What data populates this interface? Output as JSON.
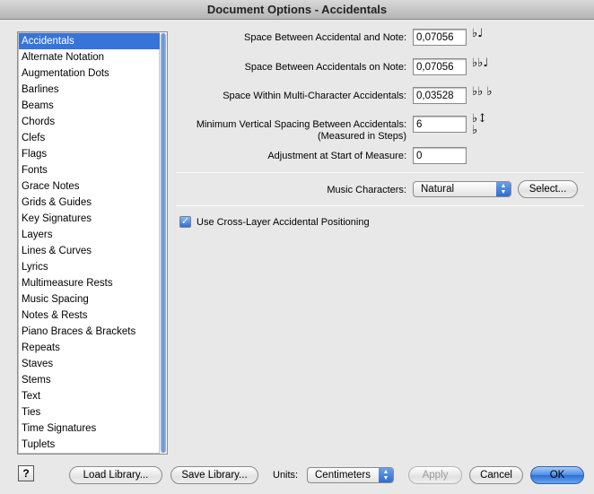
{
  "window": {
    "title": "Document Options - Accidentals"
  },
  "sidebar": {
    "items": [
      {
        "label": "Accidentals",
        "selected": true
      },
      {
        "label": "Alternate Notation"
      },
      {
        "label": "Augmentation Dots"
      },
      {
        "label": "Barlines"
      },
      {
        "label": "Beams"
      },
      {
        "label": "Chords"
      },
      {
        "label": "Clefs"
      },
      {
        "label": "Flags"
      },
      {
        "label": "Fonts"
      },
      {
        "label": "Grace Notes"
      },
      {
        "label": "Grids & Guides"
      },
      {
        "label": "Key Signatures"
      },
      {
        "label": "Layers"
      },
      {
        "label": "Lines & Curves"
      },
      {
        "label": "Lyrics"
      },
      {
        "label": "Multimeasure Rests"
      },
      {
        "label": "Music Spacing"
      },
      {
        "label": "Notes & Rests"
      },
      {
        "label": "Piano Braces & Brackets"
      },
      {
        "label": "Repeats"
      },
      {
        "label": "Staves"
      },
      {
        "label": "Stems"
      },
      {
        "label": "Text"
      },
      {
        "label": "Ties"
      },
      {
        "label": "Time Signatures"
      },
      {
        "label": "Tuplets"
      }
    ]
  },
  "options": {
    "space_acc_note": {
      "label": "Space Between Accidental and Note:",
      "value": "0,07056"
    },
    "space_acc_acc": {
      "label": "Space Between Accidentals on Note:",
      "value": "0,07056"
    },
    "space_multi": {
      "label": "Space Within Multi-Character Accidentals:",
      "value": "0,03528"
    },
    "min_vertical": {
      "label_line1": "Minimum Vertical Spacing Between Accidentals:",
      "label_line2": "(Measured in Steps)",
      "value": "6"
    },
    "adjust_start": {
      "label": "Adjustment at Start of Measure:",
      "value": "0"
    },
    "music_characters": {
      "label": "Music Characters:",
      "value": "Natural",
      "select_label": "Select..."
    },
    "cross_layer": {
      "label": "Use Cross-Layer Accidental Positioning",
      "checked": true
    }
  },
  "footer": {
    "help_label": "?",
    "load_library": "Load Library...",
    "save_library": "Save Library...",
    "units_label": "Units:",
    "units_value": "Centimeters",
    "apply": "Apply",
    "cancel": "Cancel",
    "ok": "OK"
  },
  "colors": {
    "selection": "#3874d8",
    "default_button": "#4a8de6"
  }
}
